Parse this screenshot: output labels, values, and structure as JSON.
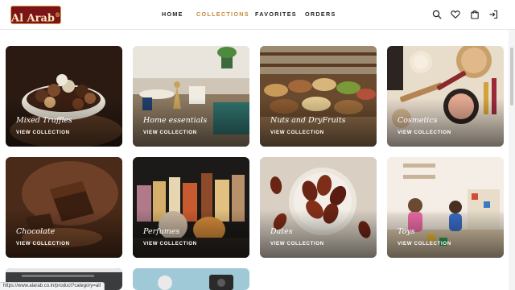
{
  "brand": {
    "logo_text": "Al Arab",
    "logo_sub": "®"
  },
  "nav": {
    "home": "HOME",
    "collections": "COLLECTIONS",
    "favorites": "FAVORITES",
    "orders": "ORDERS"
  },
  "header_icons": [
    "search-icon",
    "heart-icon",
    "bag-icon",
    "login-icon"
  ],
  "cards": [
    {
      "title": "Mixed Truffles",
      "cta": "VIEW COLLECTION"
    },
    {
      "title": "Home essentials",
      "cta": "VIEW COLLECTION"
    },
    {
      "title": "Nuts and DryFruits",
      "cta": "VIEW COLLECTION"
    },
    {
      "title": "Cosmetics",
      "cta": "VIEW COLLECTION"
    },
    {
      "title": "Chocolate",
      "cta": "VIEW COLLECTION"
    },
    {
      "title": "Perfumes",
      "cta": "VIEW COLLECTION"
    },
    {
      "title": "Dates",
      "cta": "VIEW COLLECTION"
    },
    {
      "title": "Toys",
      "cta": "VIEW COLLECTION"
    }
  ],
  "status_url": "https://www.alarab.co.in/product?category=all",
  "colors": {
    "brand": "#7b1419",
    "accent": "#c08a3a"
  }
}
